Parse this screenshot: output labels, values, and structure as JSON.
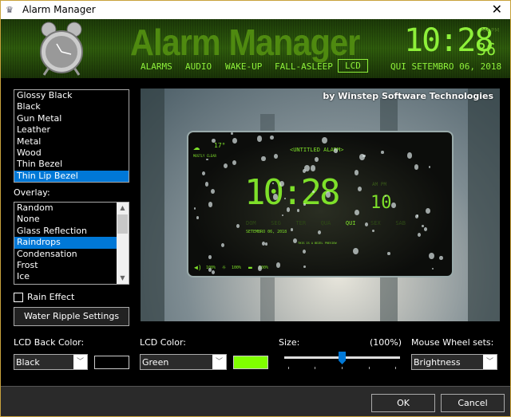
{
  "window": {
    "title": "Alarm Manager",
    "close_label": "✕"
  },
  "header": {
    "brand": "Alarm Manager",
    "time": "10:28",
    "seconds": "36",
    "ampm": "AM PM",
    "date": "QUI SETEMBRO 06, 2018",
    "tabs": [
      {
        "label": "ALARMS"
      },
      {
        "label": "AUDIO"
      },
      {
        "label": "WAKE-UP"
      },
      {
        "label": "FALL-ASLEEP"
      },
      {
        "label": "LCD",
        "selected": true
      }
    ]
  },
  "bezel_list": {
    "items": [
      "Glossy Black",
      "Black",
      "Gun Metal",
      "Leather",
      "Metal",
      "Wood",
      "Thin Bezel",
      "Thin Lip Bezel"
    ],
    "selected": "Thin Lip Bezel"
  },
  "overlay": {
    "label": "Overlay:",
    "items": [
      "Random",
      "None",
      "Glass Reflection",
      "Raindrops",
      "Condensation",
      "Frost",
      "Ice"
    ],
    "selected": "Raindrops"
  },
  "rain_effect": {
    "label": "Rain Effect",
    "checked": false
  },
  "water_ripple_button": "Water Ripple Settings",
  "preview": {
    "byline": "by Winstep Software Technologies",
    "temp": "17°",
    "weather": "MOSTLY CLEAR",
    "alarm_name": "<UNTITLED ALARM>",
    "time": "10:28",
    "seconds": "10",
    "ampm": "AM PM",
    "days": [
      "DOM",
      "SEG",
      "TER",
      "QUA",
      "QUI",
      "SEX",
      "SAB"
    ],
    "active_day": "QUI",
    "date": "SETEMBRO 06, 2018",
    "message": "THIS IS A BEZEL PREVIEW",
    "volume": "100%",
    "brightness": "100%",
    "battery": "100%"
  },
  "lcd_back_color": {
    "label": "LCD Back Color:",
    "value": "Black",
    "swatch": "#000000"
  },
  "lcd_color": {
    "label": "LCD Color:",
    "value": "Green",
    "swatch": "#80ff00"
  },
  "size": {
    "label": "Size:",
    "value_label": "(100%)",
    "slider_fraction": 0.5
  },
  "mouse_wheel": {
    "label": "Mouse Wheel sets:",
    "value": "Brightness"
  },
  "buttons": {
    "ok": "OK",
    "cancel": "Cancel"
  },
  "colors": {
    "accent": "#0078d7",
    "lcd_green": "#7ee02a"
  }
}
